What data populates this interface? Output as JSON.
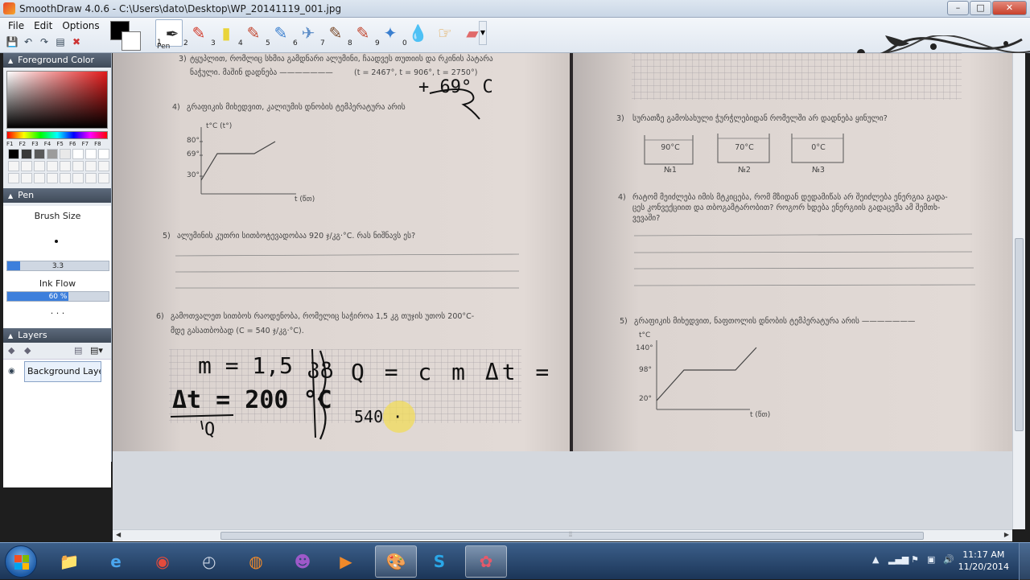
{
  "window": {
    "title": "SmoothDraw 4.0.6 - C:\\Users\\dato\\Desktop\\WP_20141119_001.jpg",
    "minimize": "–",
    "maximize": "□",
    "close": "✕"
  },
  "menu": {
    "file": "File",
    "edit": "Edit",
    "options": "Options"
  },
  "toolbar": {
    "selected_tool_label": "Pen",
    "tools": [
      {
        "num": "1",
        "icon": "pen-icon",
        "glyph": "✒",
        "color": "#2b2b2b"
      },
      {
        "num": "2",
        "icon": "pencil-icon",
        "glyph": "✎",
        "color": "#d23a2a"
      },
      {
        "num": "3",
        "icon": "highlighter-icon",
        "glyph": "▮",
        "color": "#e9d43a"
      },
      {
        "num": "4",
        "icon": "crayon-icon",
        "glyph": "✎",
        "color": "#c2462f"
      },
      {
        "num": "5",
        "icon": "marker-icon",
        "glyph": "✎",
        "color": "#3a7fcf"
      },
      {
        "num": "6",
        "icon": "airbrush-icon",
        "glyph": "✈",
        "color": "#5f8fc8"
      },
      {
        "num": "7",
        "icon": "brush-icon",
        "glyph": "✎",
        "color": "#7a4a2a"
      },
      {
        "num": "8",
        "icon": "oil-brush-icon",
        "glyph": "✎",
        "color": "#c2462f"
      },
      {
        "num": "9",
        "icon": "star-spray-icon",
        "glyph": "✦",
        "color": "#3a7fcf"
      },
      {
        "num": "0",
        "icon": "water-drop-icon",
        "glyph": "💧",
        "color": "#3a7fcf"
      },
      {
        "num": "",
        "icon": "smudge-icon",
        "glyph": "☞",
        "color": "#e0a040"
      },
      {
        "num": "",
        "icon": "eraser-icon",
        "glyph": "▰",
        "color": "#e06a6a"
      }
    ]
  },
  "left_panel": {
    "foreground_title": "Foreground Color",
    "fkeys": [
      "F1",
      "F2",
      "F3",
      "F4",
      "F5",
      "F6",
      "F7",
      "F8"
    ],
    "palette": [
      "#000000",
      "#3a3a3a",
      "#5a5a5a",
      "#9c9c9c",
      "#e9e9e9",
      "#ffffff",
      "#ffffff",
      "#ffffff",
      "#f5f5f5",
      "#f5f5f5",
      "#f5f5f5",
      "#f5f5f5",
      "#f5f5f5",
      "#f5f5f5",
      "#f5f5f5",
      "#f5f5f5",
      "#f5f5f5",
      "#f5f5f5",
      "#f5f5f5",
      "#f5f5f5",
      "#f5f5f5",
      "#f5f5f5",
      "#f5f5f5",
      "#f5f5f5"
    ],
    "pen_title": "Pen",
    "brush_size_label": "Brush Size",
    "brush_size_value": "3.3",
    "brush_size_fraction": 0.13,
    "ink_flow_label": "Ink Flow",
    "ink_flow_value": "60 %",
    "ink_flow_fraction": 0.6,
    "more": ". . .",
    "layers_title": "Layers",
    "layer_name": "Background Layer"
  },
  "document": {
    "left": {
      "q3_num": "3)",
      "q3_line1": "ტყუპლით, რომლიც სხმია გამდნარი ალუმინი, ჩაადვეს თუთიის და რკინის პატარა",
      "q3_line2": "ნაჭული. მაშინ დადნება ———————",
      "q3_temps": "(t = 2467°, t = 906°, t = 2750°)",
      "q4_num": "4)",
      "q4_text": "გრაფიკის მიხედვით, კალიუმის დნობის ტემპერატურა არის",
      "q4_y_axis": "t°C (t°)",
      "q4_ticks": [
        "80°",
        "69°",
        "30°"
      ],
      "q4_x_axis": "t (წთ)",
      "q5_num": "5)",
      "q5_text": "ალუმინის კუთრი სითბოტევადობაა 920 ჯ/კგ·°C. რას ნიშნავს ეს?",
      "q6_num": "6)",
      "q6_line1": "გამოთვალეთ სითბოს რაოდენობა, რომელიც საჭიროა 1,5 კგ თუჯის უთოს 200°C-",
      "q6_line2": "მდე გასათბობად (C = 540 ჯ/კგ·°C).",
      "handwriting": {
        "m": "m = 1,5 კგ",
        "dt": "Δt = 200 °C",
        "q": "Q",
        "formula": "Q = c m Δt =",
        "calc": "540 ·",
        "annot": "+ 69° C"
      }
    },
    "right": {
      "q3_num": "3)",
      "q3_text": "სურათზე გამოსახული ჭურჭლებიდან რომელში არ დადნება ყინული?",
      "vessels": [
        {
          "temp": "90°C",
          "label": "№1"
        },
        {
          "temp": "70°C",
          "label": "№2"
        },
        {
          "temp": "0°C",
          "label": "№3"
        }
      ],
      "q4_num": "4)",
      "q4_line1": "რატომ მეიძლება იმის მტკიცება, რომ მზიდან დედამიწას არ შეიძლება ენერგია გადა-",
      "q4_line2": "ცეს კონვექციით და თბოგამტარობით? როგორ ხდება ენერგიის გადაცემა ამ შემთხ-",
      "q4_line3": "ვევაში?",
      "q5_num": "5)",
      "q5_text": "გრაფიკის მიხედვით, ნაფთოლის დნობის ტემპერატურა არის ———————",
      "q5_y_axis": "t°C",
      "q5_ticks": [
        "140°",
        "98°",
        "20°"
      ],
      "q5_x_axis": "t (წთ)"
    }
  },
  "taskbar": {
    "time": "11:17 AM",
    "date": "11/20/2014",
    "apps": [
      {
        "icon": "folder-icon",
        "glyph": "📁",
        "color": "#f2c760"
      },
      {
        "icon": "internet-explorer-icon",
        "glyph": "e",
        "color": "#4aa6ee"
      },
      {
        "icon": "chrome-icon",
        "glyph": "◉",
        "color": "#e44b3c"
      },
      {
        "icon": "clock-app-icon",
        "glyph": "◴",
        "color": "#cfd8e6"
      },
      {
        "icon": "firefox-icon",
        "glyph": "◍",
        "color": "#f08a2a"
      },
      {
        "icon": "messenger-icon",
        "glyph": "☻",
        "color": "#9e59c9"
      },
      {
        "icon": "media-player-icon",
        "glyph": "▶",
        "color": "#f0892a"
      },
      {
        "icon": "paint-icon",
        "glyph": "🎨",
        "color": "#3a7fcf"
      },
      {
        "icon": "skype-icon",
        "glyph": "S",
        "color": "#2aa7e8"
      },
      {
        "icon": "smoothdraw-icon",
        "glyph": "✿",
        "color": "#e6596a"
      }
    ]
  }
}
